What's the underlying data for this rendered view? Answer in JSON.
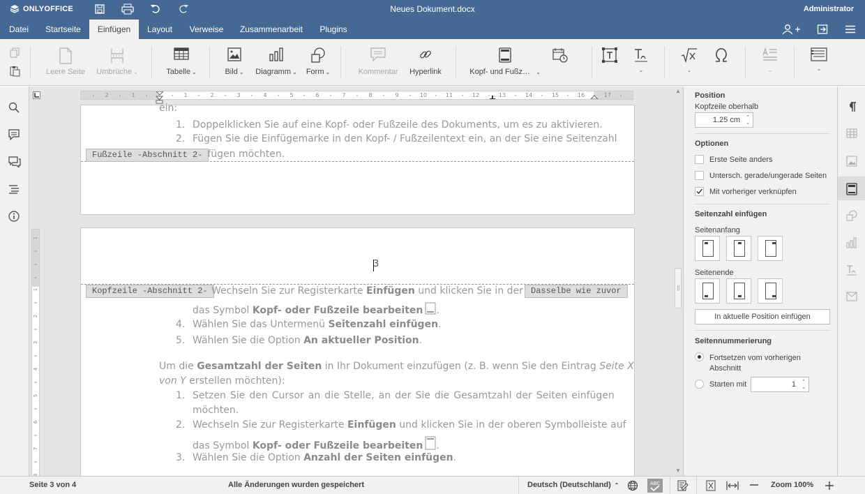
{
  "app": {
    "brand": "ONLYOFFICE",
    "document_title": "Neues Dokument.docx",
    "user": "Administrator"
  },
  "menu": {
    "tabs": [
      {
        "label": "Datei"
      },
      {
        "label": "Startseite"
      },
      {
        "label": "Einfügen"
      },
      {
        "label": "Layout"
      },
      {
        "label": "Verweise"
      },
      {
        "label": "Zusammenarbeit"
      },
      {
        "label": "Plugins"
      }
    ],
    "active_tab": "Einfügen"
  },
  "toolbar": {
    "blank_page": "Leere Seite",
    "breaks": "Umbrüche",
    "table": "Tabelle",
    "image": "Bild",
    "chart": "Diagramm",
    "shape": "Form",
    "comment": "Kommentar",
    "hyperlink": "Hyperlink",
    "header_footer": "Kopf- und Fußz…"
  },
  "ruler": {
    "h_ticks": [
      "2",
      "1",
      "1",
      "2",
      "3",
      "4",
      "5",
      "6",
      "7",
      "8",
      "9",
      "10",
      "11",
      "12",
      "13",
      "14",
      "15",
      "16",
      "17"
    ],
    "v_ticks": [
      "1",
      "1",
      "2",
      "3",
      "4",
      "5",
      "6",
      "7",
      "8"
    ]
  },
  "document": {
    "page1": {
      "line0": "ein:",
      "item1_num": "1.",
      "item1": "Doppelklicken Sie auf eine Kopf- oder Fußzeile des Dokuments, um es zu aktivieren.",
      "item2_num": "2.",
      "item2": "Fügen Sie die Einfügemarke in den Kopf- / Fußzeilentext ein, an der Sie eine Seitenzahl",
      "item2b": "einfügen möchten.",
      "footer_label": "Fußzeile -Abschnitt 2-"
    },
    "page2": {
      "header_text": "3",
      "header_label": "Kopfzeile -Abschnitt 2-",
      "same_as_prev": "Dasselbe wie zuvor",
      "l1_pre": "Wechseln Sie zur Registerkarte ",
      "l1_b": "Einfügen",
      "l1_post": " und klicken Sie in der oberen Symbolleiste auf",
      "l2_pre": "das Symbol ",
      "l2_b": "Kopf- oder Fußzeile bearbeiten",
      "n4": "4.",
      "l4_pre": "Wählen Sie das Untermenü ",
      "l4_b": "Seitenzahl einfügen",
      "n5": "5.",
      "l5_pre": "Wählen Sie die Option ",
      "l5_b": "An aktueller Position",
      "p_pre": "Um die ",
      "p_b": "Gesamtzahl der Seiten",
      "p_mid": " in Ihr Dokument einzufügen (z. B. wenn Sie den Eintrag ",
      "p_i": "Seite X",
      "p2_i": "von Y",
      "p2_post": " erstellen möchten):",
      "s1_num": "1.",
      "s1": "Setzen Sie den Cursor an die Stelle, an der Sie die Gesamtzahl der Seiten einfügen",
      "s1b": "möchten.",
      "s2_num": "2.",
      "s2_pre": "Wechseln Sie zur Registerkarte ",
      "s2_b": "Einfügen",
      "s2_post": " und klicken Sie in der oberen Symbolleiste auf",
      "s2b_pre": "das Symbol ",
      "s2b_b": "Kopf- oder Fußzeile bearbeiten",
      "s3_num": "3.",
      "s3_pre": "Wählen Sie die Option ",
      "s3_b": "Anzahl der Seiten einfügen"
    }
  },
  "right_panel": {
    "position_title": "Position",
    "header_above_label": "Kopfzeile oberhalb",
    "header_above_value": "1.25 cm",
    "options_title": "Optionen",
    "opt_first_page": "Erste Seite anders",
    "opt_odd_even": "Untersch. gerade/ungerade Seiten",
    "opt_link_previous": "Mit vorheriger verknüpfen",
    "page_number_title": "Seitenzahl einfügen",
    "page_top_label": "Seitenanfang",
    "page_bottom_label": "Seitenende",
    "insert_current_button": "In aktuelle Position einfügen",
    "numbering_title": "Seitennummerierung",
    "continue_prev": "Fortsetzen vom vorherigen Abschnitt",
    "continue_prev_1": "Fortsetzen vom vorherigen",
    "continue_prev_2": "Abschnitt",
    "start_with": "Starten mit",
    "start_with_value": "1"
  },
  "status": {
    "page": "Seite 3 von 4",
    "saved": "Alle Änderungen wurden gespeichert",
    "language": "Deutsch (Deutschland)",
    "zoom": "Zoom 100%"
  },
  "colors": {
    "header_blue": "#446995",
    "toolbar_bg": "#f1f1f1",
    "canvas_bg": "#e5e5e5"
  }
}
